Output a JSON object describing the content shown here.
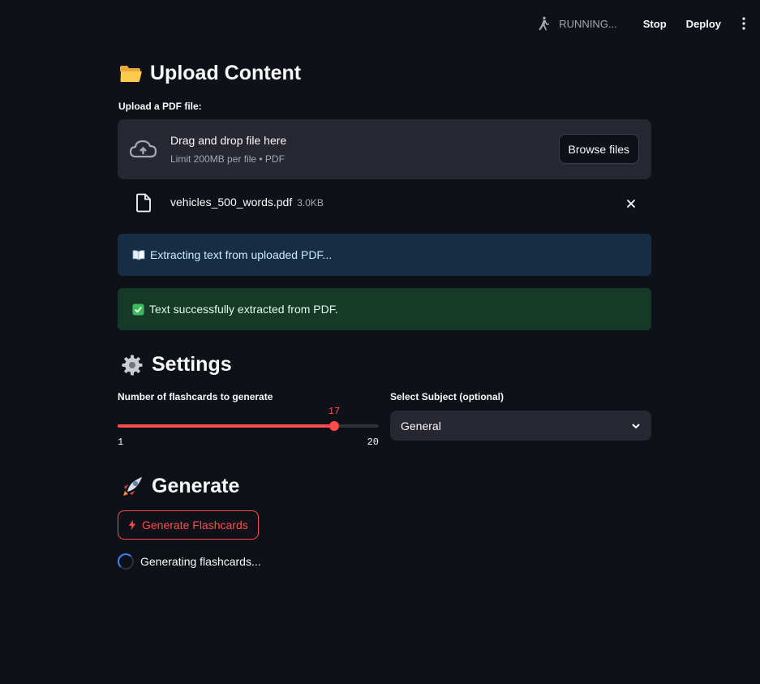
{
  "toolbar": {
    "status": "RUNNING...",
    "stop_label": "Stop",
    "deploy_label": "Deploy",
    "status_icon": "running-person-icon",
    "menu_icon": "kebab-menu-icon"
  },
  "upload": {
    "heading": "Upload Content",
    "heading_icon": "folder-icon",
    "field_label": "Upload a PDF file:",
    "drop_title": "Drag and drop file here",
    "drop_subtitle": "Limit 200MB per file • PDF",
    "browse_label": "Browse files",
    "file_name": "vehicles_500_words.pdf",
    "file_size": "3.0KB"
  },
  "alerts": {
    "info_text": "Extracting text from uploaded PDF...",
    "success_text": "Text successfully extracted from PDF."
  },
  "settings": {
    "heading": "Settings",
    "heading_icon": "gear-icon",
    "slider_label": "Number of flashcards to generate",
    "slider_min": 1,
    "slider_max": 20,
    "slider_value": 17,
    "select_label": "Select Subject (optional)",
    "select_value": "General"
  },
  "generate": {
    "heading": "Generate",
    "heading_icon": "rocket-icon",
    "button_label": "Generate Flashcards",
    "status_text": "Generating flashcards..."
  },
  "colors": {
    "background": "#0e1117",
    "accent": "#ff4b4b",
    "panel": "#262730",
    "info_bg": "#172d43",
    "success_bg": "#173928"
  }
}
